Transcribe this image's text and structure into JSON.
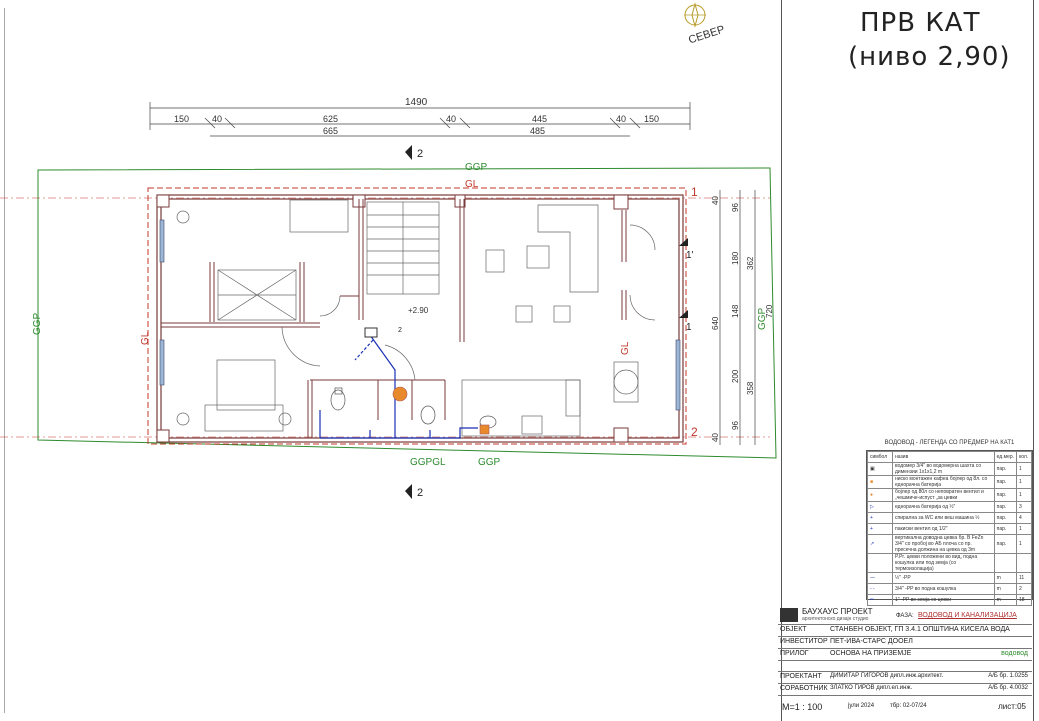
{
  "sheet": {
    "title_line1": "ПРВ КАТ",
    "title_line2": "(ниво 2,90)",
    "north_label": "СЕВЕР"
  },
  "dimensions": {
    "overall": "1490",
    "top_row": [
      "150",
      "40",
      "625",
      "40",
      "445",
      "40",
      "150"
    ],
    "second_row": [
      "665",
      "485"
    ],
    "right_col_a": [
      "40",
      "96",
      "180",
      "148",
      "200",
      "96",
      "40"
    ],
    "right_col_b": [
      "362",
      "358"
    ],
    "right_overall": "640",
    "right_overall2": "720"
  },
  "plan_labels": {
    "ggp": "GGP",
    "gl": "GL",
    "section_marker": "2",
    "axis_1": "1",
    "axis_2": "2",
    "axis_1prime": "1'",
    "level_mark": "+2.90",
    "ggp_gl_bottom": "GGPGL",
    "stair_note": "2"
  },
  "legend": {
    "header": "ВОДОВОД - ЛЕГЕНДА СО ПРЕДМЕР НА КАТ1",
    "columns": [
      "симбол",
      "назив",
      "ед.мер.",
      "кол."
    ],
    "rows": [
      {
        "name": "водомер 3/4\" во водомерна шахта со димензии 1x1x1,2 m",
        "unit": "пар.",
        "qty": "1"
      },
      {
        "name": "нискo монтажен кафеа бојлер од 8л. со еднорачна батерија",
        "unit": "пар.",
        "qty": "1"
      },
      {
        "name": "бојлер од 80л со неповратен вентил и „чешмичe-испуст „за цевки",
        "unit": "пар.",
        "qty": "1"
      },
      {
        "name": "еднорачна батерија од ½\"",
        "unit": "пар.",
        "qty": "3"
      },
      {
        "name": "спирална за WC или веш машина ½",
        "unit": "пар.",
        "qty": "4"
      },
      {
        "name": "пакиски вентил од 1/2\"",
        "unit": "пар.",
        "qty": "1"
      },
      {
        "name": "вертикална доводна цевка бр. В FeZn 3/4\" со пробој во АБ плоча со пр. пресечна должина на цевка од 3m",
        "unit": "пар.",
        "qty": "1"
      },
      {
        "name": "P.Pr. цевки положени во вид, подна кошулка или под земја (со термоизолација)",
        "unit": "",
        "qty": ""
      },
      {
        "name": "½\" -PP",
        "unit": "m",
        "qty": "11"
      },
      {
        "name": "3/4\" -PP во подна кошулка",
        "unit": "m",
        "qty": "2"
      },
      {
        "name": "1\" -PP во земја со цевки",
        "unit": "m",
        "qty": "18"
      }
    ]
  },
  "title_block": {
    "company": "БАУХАУС ПРОЕКТ",
    "company_sub": "архитектонско дизајн студио",
    "phase_label": "ФАЗА:",
    "phase_value": "ВОДОВОД И КАНАЛИЗАЦИЈА",
    "object_label": "ОБЈЕКТ",
    "object_value": "СТАНБЕН ОБЈЕКТ,   ГП 3.4.1 ОПШТИНА КИСЕЛА ВОДА",
    "investor_label": "ИНВЕСТИТОР",
    "investor_value": "ПЕТ-ИВА-СТАРС ДООЕЛ",
    "appendix_label": "ПРИЛОГ",
    "appendix_value": "ОСНОВА НА ПРИЗЕМЈЕ",
    "appendix_right": "водовод",
    "designer_label": "ПРОЕКТАНТ",
    "designer_value": "ДИМИТАР ГИГОРОВ дипл.инж.архитект.",
    "designer_lic": "А/Б бр. 1.0255",
    "associate_label": "СОРАБОТНИК",
    "associate_value": "ЗЛАТКО  ГИРОВ  дипл.ел.инж.",
    "associate_lic": "А/Б бр. 4.0032",
    "scale": "M=1 : 100",
    "date": "јули 2024",
    "tbr": "тбр:  02-07/24",
    "sheet_no": "лист:05"
  },
  "colors": {
    "wall": "#7a3a3a",
    "axis_line": "#c0392b",
    "plot_boundary": "#2e8b2e",
    "water_pipe": "#1a2fb5",
    "boiler": "#e8892b"
  }
}
